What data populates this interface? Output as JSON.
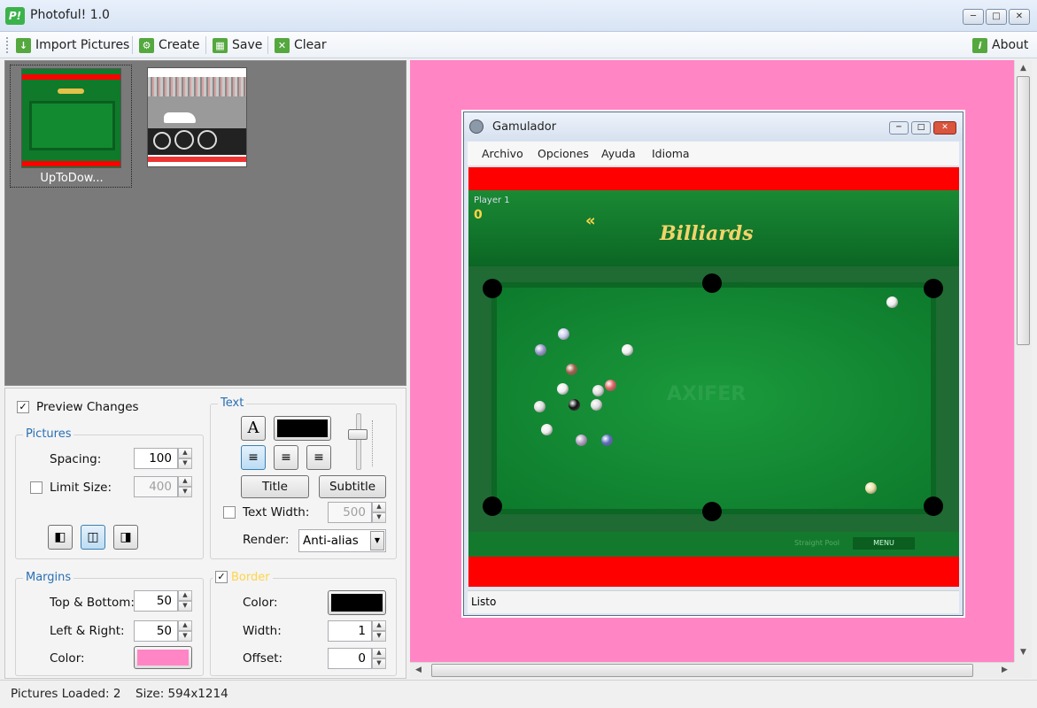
{
  "window": {
    "title": "Photoful! 1.0",
    "icon_text": "P!"
  },
  "toolbar": {
    "import_label": "Import Pictures",
    "create_label": "Create",
    "save_label": "Save",
    "clear_label": "Clear",
    "about_label": "About"
  },
  "thumbnails": [
    {
      "label": "UpToDow..."
    },
    {
      "label": ""
    }
  ],
  "settings": {
    "preview_changes": {
      "label": "Preview Changes",
      "checked": true
    },
    "pictures": {
      "legend": "Pictures",
      "spacing_label": "Spacing:",
      "spacing_value": "100",
      "limit_size_label": "Limit Size:",
      "limit_size_checked": false,
      "limit_size_value": "400"
    },
    "margins": {
      "legend": "Margins",
      "top_bottom_label": "Top & Bottom:",
      "top_bottom_value": "50",
      "left_right_label": "Left & Right:",
      "left_right_value": "50",
      "color_label": "Color:",
      "color": "#ff85c5"
    },
    "text": {
      "legend": "Text",
      "font_glyph": "A",
      "color": "#000000",
      "title_button": "Title",
      "subtitle_button": "Subtitle",
      "text_width_label": "Text Width:",
      "text_width_checked": false,
      "text_width_value": "500",
      "render_label": "Render:",
      "render_value": "Anti-alias",
      "slider_level": 0.5
    },
    "border": {
      "legend": "Border",
      "checked": true,
      "color_label": "Color:",
      "color": "#000000",
      "width_label": "Width:",
      "width_value": "1",
      "offset_label": "Offset:",
      "offset_value": "0"
    }
  },
  "preview": {
    "game_window": {
      "title": "Gamulador",
      "menu": [
        "Archivo",
        "Opciones",
        "Ayuda",
        "Idioma"
      ],
      "player_label": "Player 1",
      "score": "0",
      "logo": "Billiards",
      "watermark": "AXIFER",
      "mode_label": "Straight Pool",
      "menu_button": "MENU",
      "status": "Listo"
    }
  },
  "statusbar": {
    "pictures_loaded": "Pictures Loaded: 2",
    "size": "Size: 594x1214"
  },
  "colors": {
    "accent": "#2a6fb4",
    "table_green": "#0f7a2a",
    "banner_red": "#ff0000"
  }
}
